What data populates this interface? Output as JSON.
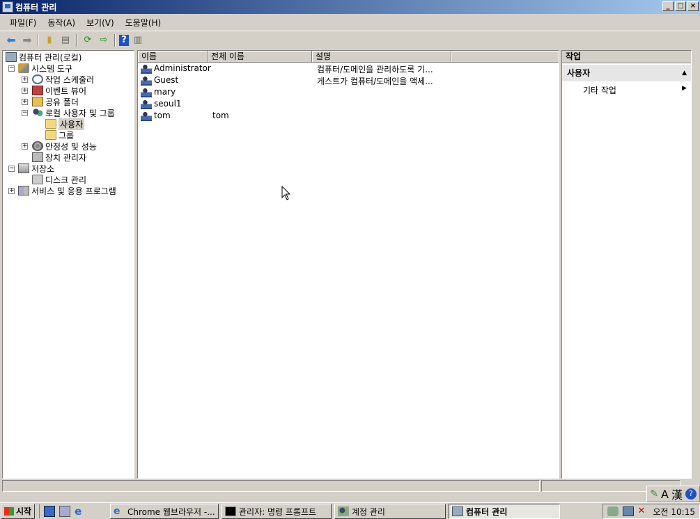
{
  "window": {
    "title": "컴퓨터 관리",
    "buttons": [
      "_",
      "□",
      "×"
    ]
  },
  "menubar": [
    "파일(F)",
    "동작(A)",
    "보기(V)",
    "도움말(H)"
  ],
  "tree": {
    "root": "컴퓨터 관리(로컬)",
    "system_tools": "시스템 도구",
    "task_scheduler": "작업 스케줄러",
    "event_viewer": "이벤트 뷰어",
    "shared_folders": "공유 폴더",
    "local_users_groups": "로컬 사용자 및 그룹",
    "users": "사용자",
    "groups": "그룹",
    "reliability": "안정성 및 성능",
    "device_manager": "장치 관리자",
    "storage": "저장소",
    "disk_management": "디스크 관리",
    "services_apps": "서비스 및 응용 프로그램"
  },
  "list": {
    "columns": [
      "이름",
      "전체 이름",
      "설명"
    ],
    "rows": [
      {
        "name": "Administrator",
        "full_name": "",
        "description": "컴퓨터/도메인을 관리하도록 기..."
      },
      {
        "name": "Guest",
        "full_name": "",
        "description": "게스트가 컴퓨터/도메인을 액세..."
      },
      {
        "name": "mary",
        "full_name": "",
        "description": ""
      },
      {
        "name": "seoul1",
        "full_name": "",
        "description": ""
      },
      {
        "name": "tom",
        "full_name": "tom",
        "description": ""
      }
    ]
  },
  "actions": {
    "header": "작업",
    "section": "사용자",
    "item": "기타 작업"
  },
  "langbar": {
    "lang": "A",
    "hanja": "漢",
    "help": "?"
  },
  "taskbar": {
    "start": "시작",
    "tasks": [
      "Chrome 웹브라우저 -...",
      "관리자: 명령 프롬프트",
      "계정 관리",
      "컴퓨터 관리"
    ],
    "clock": "오전 10:15"
  }
}
